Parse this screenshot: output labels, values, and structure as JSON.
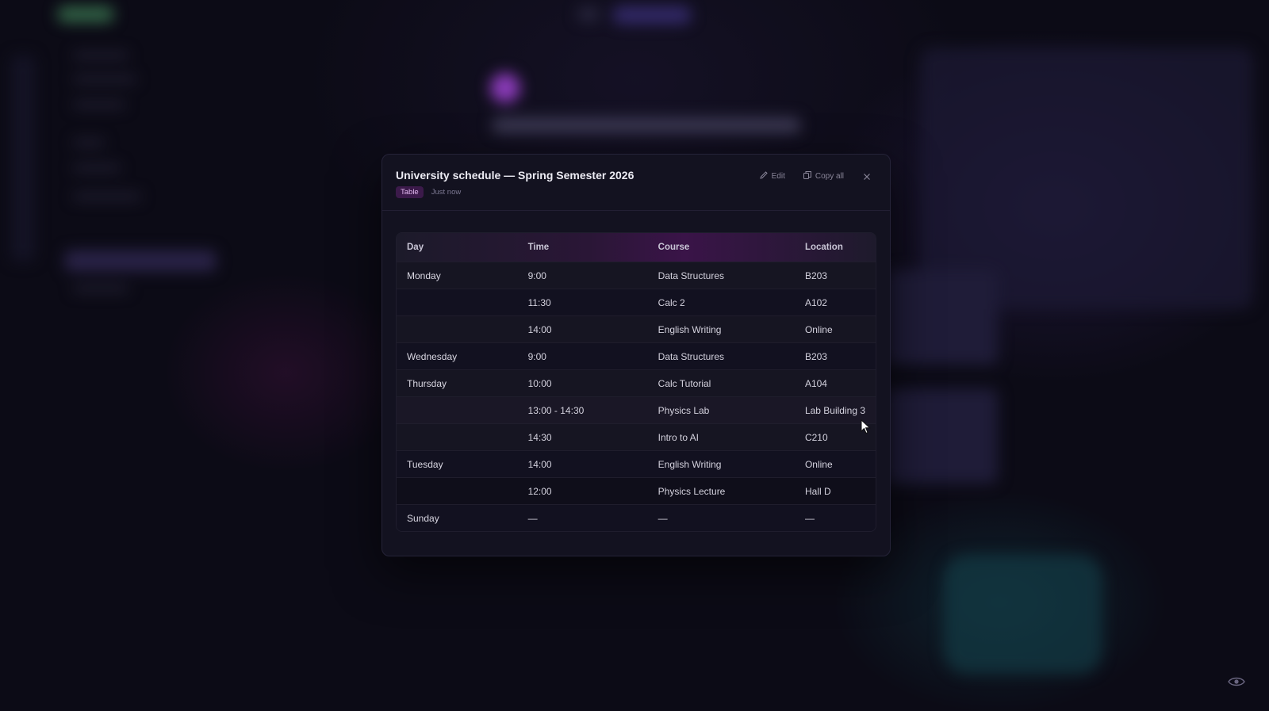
{
  "modal": {
    "title": "University schedule — Spring Semester 2026",
    "tag": "Table",
    "timestamp": "Just now",
    "actions": {
      "edit_label": "Edit",
      "copy_label": "Copy all",
      "edit_icon": "pencil-icon",
      "copy_icon": "copy-icon",
      "close_icon": "close-icon"
    }
  },
  "table": {
    "headers": [
      "Day",
      "Time",
      "Course",
      "Location"
    ],
    "rows": [
      {
        "day": "Monday",
        "time": "9:00",
        "course": "Data Structures",
        "location": "B203"
      },
      {
        "day": "",
        "time": "11:30",
        "course": "Calc 2",
        "location": "A102"
      },
      {
        "day": "",
        "time": "14:00",
        "course": "English Writing",
        "location": "Online"
      },
      {
        "day": "Wednesday",
        "time": "9:00",
        "course": "Data Structures",
        "location": "B203"
      },
      {
        "day": "Thursday",
        "time": "10:00",
        "course": "Calc Tutorial",
        "location": "A104"
      },
      {
        "day": "",
        "time": "13:00 - 14:30",
        "course": "Physics Lab",
        "location": "Lab Building 3"
      },
      {
        "day": "",
        "time": "14:30",
        "course": "Intro to AI",
        "location": "C210"
      },
      {
        "day": "Tuesday",
        "time": "14:00",
        "course": "English Writing",
        "location": "Online"
      },
      {
        "day": "",
        "time": "12:00",
        "course": "Physics Lecture",
        "location": "Hall D"
      },
      {
        "day": "Sunday",
        "time": "—",
        "course": "—",
        "location": "—"
      }
    ]
  },
  "colors": {
    "accent": "#3a1448",
    "tag_bg": "#3b1a4a",
    "tag_text": "#e2b8f0",
    "modal_bg": "#131220"
  }
}
